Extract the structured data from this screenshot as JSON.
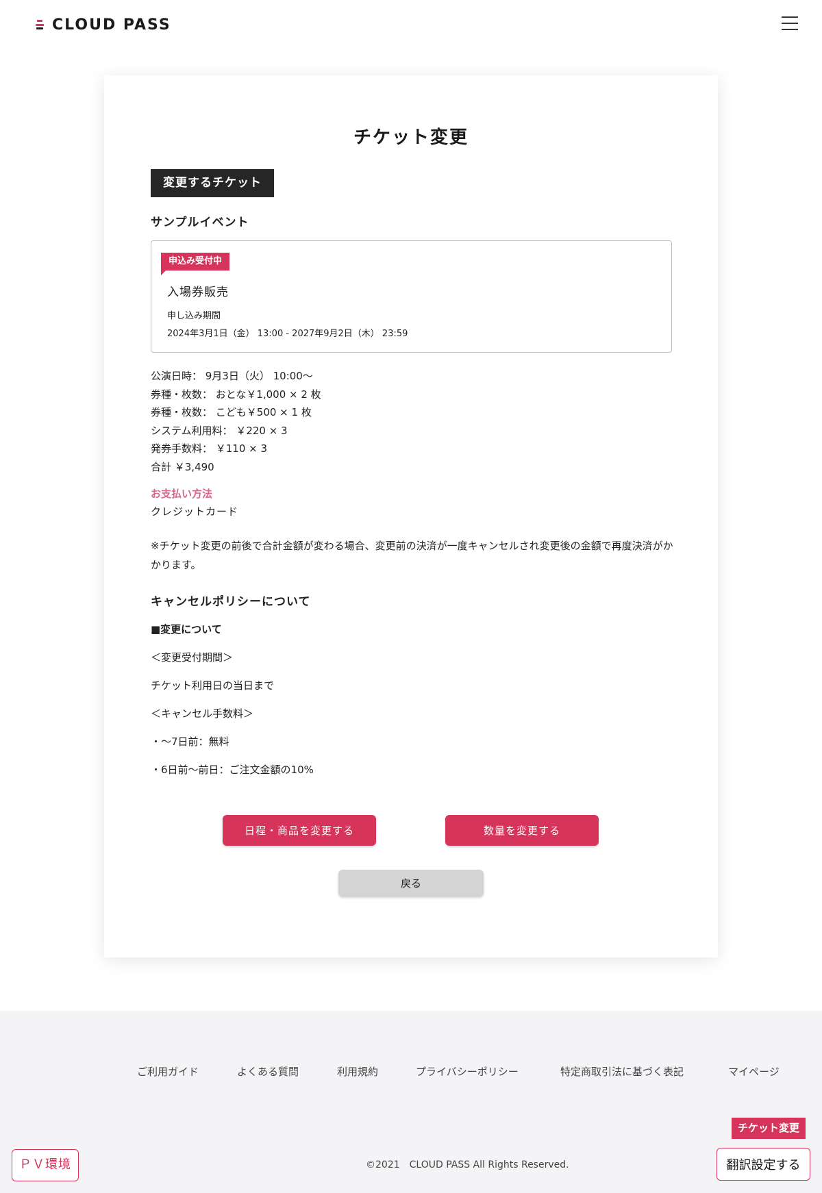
{
  "header": {
    "logo_text": "CLOUD PASS"
  },
  "main": {
    "title": "チケット変更",
    "section_label": "変更するチケット",
    "event_name": "サンプルイベント",
    "ticket": {
      "status": "申込み受付中",
      "name": "入場券販売",
      "period_label": "申し込み期間",
      "period_value": "2024年3月1日（金） 13:00 - 2027年9月2日（木） 23:59"
    },
    "details": [
      "公演日時： 9月3日（火） 10:00〜",
      "券種・枚数： おとな￥1,000 × 2 枚",
      "券種・枚数： こども￥500 × 1 枚",
      "システム利用料： ￥220 × 3",
      "発券手数料： ￥110 × 3",
      "合計 ￥3,490"
    ],
    "payment_label": "お支払い方法",
    "payment_value": "クレジットカード",
    "note": "※チケット変更の前後で合計金額が変わる場合、変更前の決済が一度キャンセルされ変更後の金額で再度決済がかかります。",
    "policy_title": "キャンセルポリシーについて",
    "policy": [
      "■変更について",
      "＜変更受付期間＞",
      "チケット利用日の当日まで",
      "＜キャンセル手数料＞",
      "・〜7日前：無料",
      "・6日前〜前日：ご注文金額の10%"
    ],
    "buttons": {
      "change_schedule": "日程・商品を変更する",
      "change_quantity": "数量を変更する",
      "back": "戻る"
    }
  },
  "footer": {
    "links": [
      "ご利用ガイド",
      "よくある質問",
      "利用規約",
      "プライバシーポリシー",
      "特定商取引法に基づく表記",
      "マイページ"
    ],
    "copyright": "©2021　CLOUD PASS All Rights Reserved.",
    "fab_ticket": "チケット変更",
    "fab_translate": "翻訳設定する",
    "pv_badge": "ＰＶ環境"
  },
  "colors": {
    "accent": "#d6345a",
    "payment_label": "#d9658a",
    "section_label_bg": "#262626",
    "footer_bg": "#f4f4f7"
  }
}
